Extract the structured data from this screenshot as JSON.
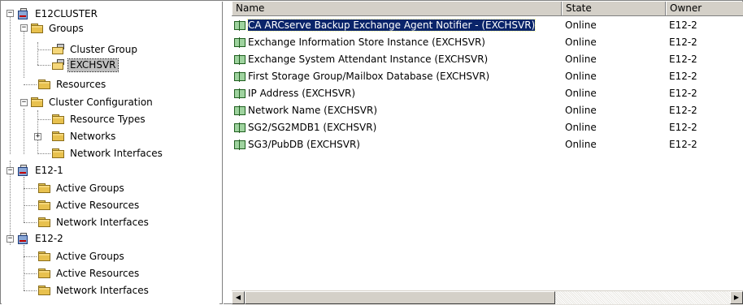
{
  "tree": {
    "root": "E12CLUSTER",
    "groups": "Groups",
    "cluster_group": "Cluster Group",
    "exchsvr": "EXCHSVR",
    "resources": "Resources",
    "cluster_configuration": "Cluster Configuration",
    "resource_types": "Resource Types",
    "networks": "Networks",
    "network_interfaces_cc": "Network Interfaces",
    "node1": "E12-1",
    "node1_active_groups": "Active Groups",
    "node1_active_resources": "Active Resources",
    "node1_network_interfaces": "Network Interfaces",
    "node2": "E12-2",
    "node2_active_groups": "Active Groups",
    "node2_active_resources": "Active Resources",
    "node2_network_interfaces": "Network Interfaces"
  },
  "list": {
    "columns": [
      "Name",
      "State",
      "Owner"
    ],
    "rows": [
      {
        "name": "CA ARCserve Backup Exchange Agent Notifier - (EXCHSVR)",
        "state": "Online",
        "owner": "E12-2"
      },
      {
        "name": "Exchange Information Store Instance (EXCHSVR)",
        "state": "Online",
        "owner": "E12-2"
      },
      {
        "name": "Exchange System Attendant Instance (EXCHSVR)",
        "state": "Online",
        "owner": "E12-2"
      },
      {
        "name": "First Storage Group/Mailbox Database (EXCHSVR)",
        "state": "Online",
        "owner": "E12-2"
      },
      {
        "name": "IP Address (EXCHSVR)",
        "state": "Online",
        "owner": "E12-2"
      },
      {
        "name": "Network Name (EXCHSVR)",
        "state": "Online",
        "owner": "E12-2"
      },
      {
        "name": "SG2/SG2MDB1 (EXCHSVR)",
        "state": "Online",
        "owner": "E12-2"
      },
      {
        "name": "SG3/PubDB (EXCHSVR)",
        "state": "Online",
        "owner": "E12-2"
      }
    ]
  },
  "scrollbar": {
    "left_arrow": "◀",
    "right_arrow": "▶"
  }
}
